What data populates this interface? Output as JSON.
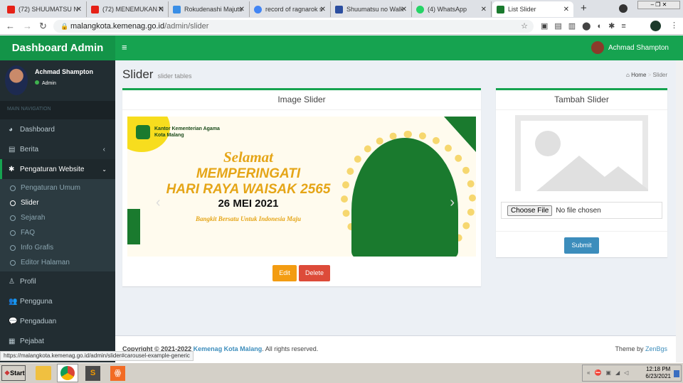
{
  "browser": {
    "tabs": [
      {
        "title": "(72) SHUUMATSU N",
        "color": "#e62117"
      },
      {
        "title": "(72) MENEMUKAN N",
        "color": "#e62117"
      },
      {
        "title": "Rokudenashi Majuts",
        "color": "#3a8ee6"
      },
      {
        "title": "record of ragnarok s",
        "color": "#4285f4"
      },
      {
        "title": "Shuumatsu no Walk",
        "color": "#2b4ea0"
      },
      {
        "title": "(4) WhatsApp",
        "color": "#25d366"
      },
      {
        "title": "List Slider",
        "color": "#1a7a2e"
      }
    ],
    "url_host": "malangkota.kemenag.go.id",
    "url_path": "/admin/slider",
    "status_url": "https://malangkota.kemenag.go.id/admin/slider#carousel-example-generic"
  },
  "header": {
    "brand": "Dashboard Admin",
    "user": "Achmad Shampton"
  },
  "sidebar": {
    "user_name": "Achmad Shampton",
    "user_role": "Admin",
    "section": "MAIN NAVIGATION",
    "items": [
      {
        "label": "Dashboard",
        "icon": "dashboard-icon"
      },
      {
        "label": "Berita",
        "icon": "newspaper-icon"
      },
      {
        "label": "Pengaturan Website",
        "icon": "gear-icon"
      }
    ],
    "subitems": [
      "Pengaturan Umum",
      "Slider",
      "Sejarah",
      "FAQ",
      "Info Grafis",
      "Editor Halaman"
    ],
    "items2": [
      {
        "label": "Profil",
        "icon": "user-icon"
      },
      {
        "label": "Pengguna",
        "icon": "users-icon"
      },
      {
        "label": "Pengaduan",
        "icon": "comments-icon"
      },
      {
        "label": "Pejabat",
        "icon": "building-icon"
      }
    ]
  },
  "page": {
    "title": "Slider",
    "subtitle": "slider tables",
    "breadcrumb_home": "Home",
    "breadcrumb_current": "Slider"
  },
  "image_box": {
    "title": "Image Slider",
    "edit": "Edit",
    "delete": "Delete",
    "banner": {
      "org1": "Kantor Kementerian Agama",
      "org2": "Kota Malang",
      "l1": "Selamat",
      "l2": "MEMPERINGATI",
      "l3": "HARI RAYA WAISAK 2565",
      "l4": "26 MEI 2021",
      "l5": "Bangkit Bersatu Untuk Indonesia Maju"
    }
  },
  "add_box": {
    "title": "Tambah Slider",
    "choose": "Choose File",
    "no_file": "No file chosen",
    "submit": "Submit"
  },
  "footer": {
    "copy": "Copyright © 2021-2022 ",
    "org": "Kemenag Kota Malang",
    "rights": ". All rights reserved.",
    "theme": "Theme by ",
    "theme_link": "ZenBgs"
  },
  "taskbar": {
    "start": "Start",
    "time": "12:18 PM",
    "date": "6/23/2021"
  }
}
